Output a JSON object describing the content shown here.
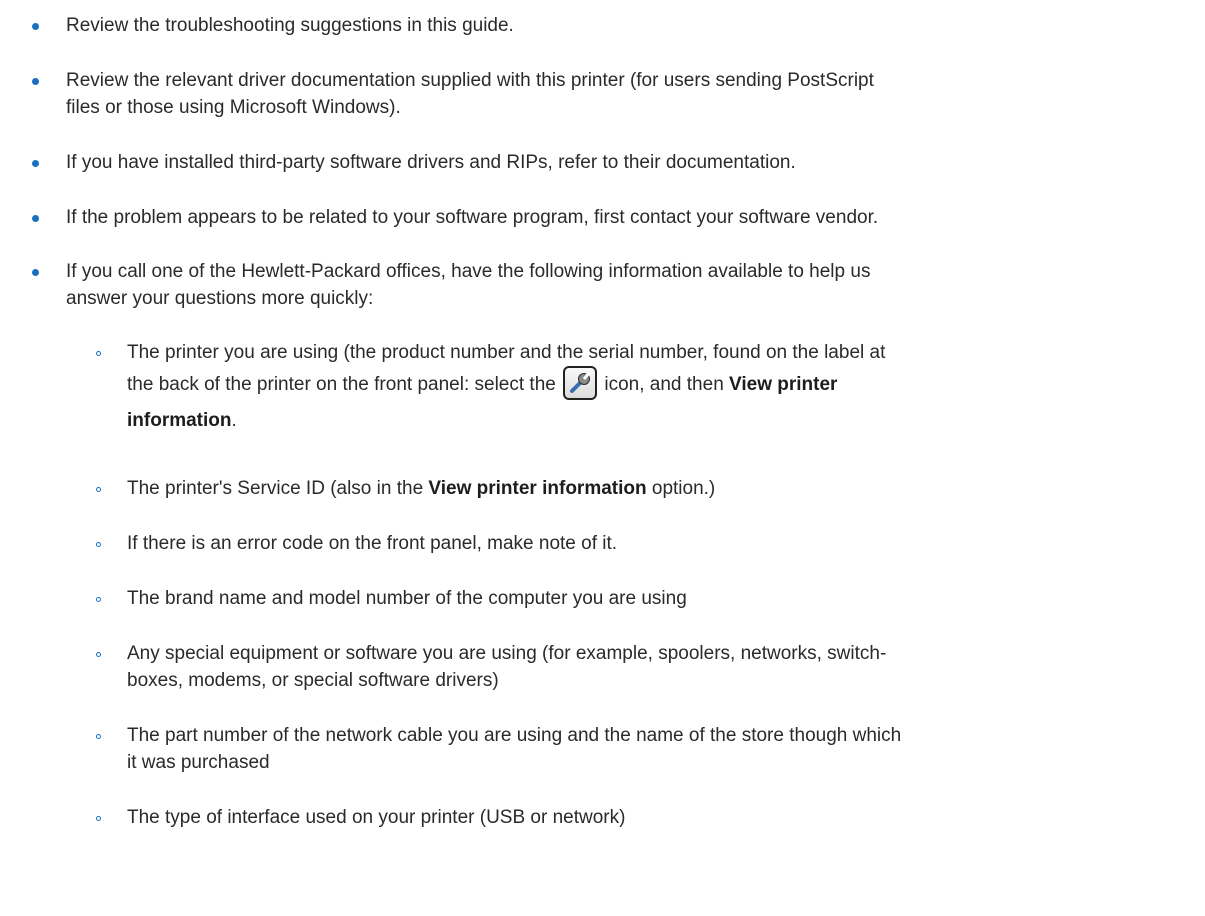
{
  "items": [
    {
      "lines": [
        "Review the troubleshooting suggestions in this guide."
      ]
    },
    {
      "lines": [
        "Review the relevant driver documentation supplied with this printer (for users sending PostScript",
        "files or those using Microsoft Windows)."
      ]
    },
    {
      "lines": [
        "If you have installed third-party software drivers and RIPs, refer to their documentation."
      ]
    },
    {
      "lines": [
        "If the problem appears to be related to your software program, first contact your software vendor."
      ]
    },
    {
      "lines": [
        "If you call one of the Hewlett-Packard offices, have the following information available to help us",
        "answer your questions more quickly:"
      ]
    }
  ],
  "subitems": {
    "printer": {
      "line1": "The printer you are using (the product number and the serial number, found on the label at",
      "line2_pre": "the back of the printer on the front panel: select the",
      "icon": "wrench-icon",
      "line2_post": "icon, and then",
      "bold1": "View printer",
      "bold2": "information",
      "end": "."
    },
    "service_id": {
      "pre": "The printer's Service ID (also in the",
      "bold": "View printer information",
      "post": "option.)"
    },
    "others": [
      {
        "lines": [
          "If there is an error code on the front panel, make note of it."
        ]
      },
      {
        "lines": [
          "The brand name and model number of the computer you are using"
        ]
      },
      {
        "lines": [
          "Any special equipment or software you are using (for example, spoolers, networks, switch-",
          "boxes, modems, or special software drivers)"
        ]
      },
      {
        "lines": [
          "The part number of the network cable you are using and the name of the store though which",
          "it was purchased"
        ]
      },
      {
        "lines": [
          "The type of interface used on your printer (USB or network)"
        ]
      }
    ]
  },
  "colors": {
    "bullet": "#1a6fbf",
    "text": "#2a2a2a"
  }
}
